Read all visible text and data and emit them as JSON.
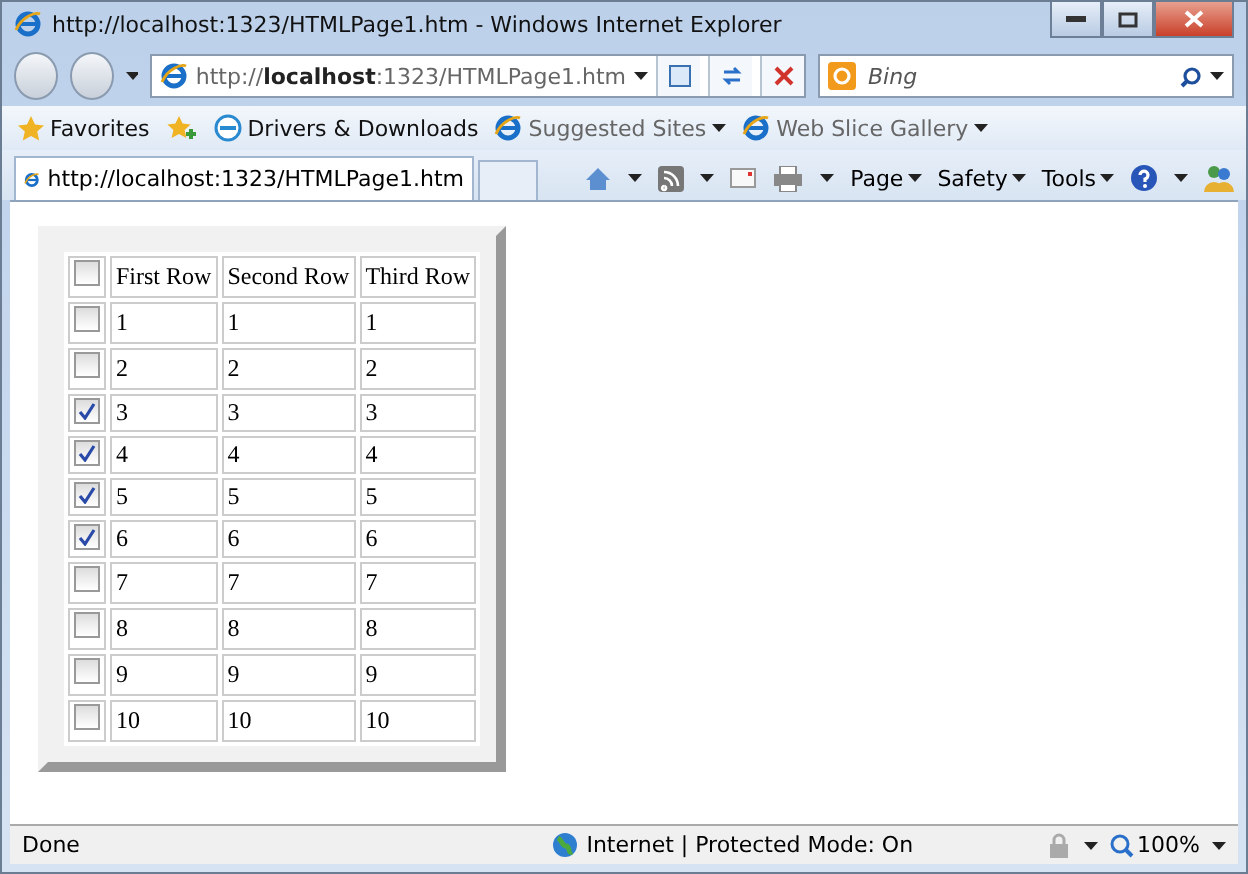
{
  "window": {
    "title": "http://localhost:1323/HTMLPage1.htm - Windows Internet Explorer"
  },
  "address": {
    "url": "http://**localhost**:1323/HTMLPage1.htm"
  },
  "search": {
    "placeholder": "Bing"
  },
  "favorites": {
    "label": "Favorites",
    "links": [
      {
        "label": "Drivers & Downloads",
        "kind": "dell",
        "dim": false,
        "dropdown": false
      },
      {
        "label": "Suggested Sites",
        "kind": "ie",
        "dim": true,
        "dropdown": true
      },
      {
        "label": "Web Slice Gallery",
        "kind": "ie",
        "dim": true,
        "dropdown": true
      }
    ]
  },
  "tab": {
    "title": "http://localhost:1323/HTMLPage1.htm"
  },
  "commands": [
    "Page",
    "Safety",
    "Tools"
  ],
  "table": {
    "header_checked": false,
    "columns": [
      "First Row",
      "Second Row",
      "Third Row"
    ],
    "rows": [
      {
        "checked": false,
        "cells": [
          "1",
          "1",
          "1"
        ]
      },
      {
        "checked": false,
        "cells": [
          "2",
          "2",
          "2"
        ]
      },
      {
        "checked": true,
        "cells": [
          "3",
          "3",
          "3"
        ]
      },
      {
        "checked": true,
        "cells": [
          "4",
          "4",
          "4"
        ]
      },
      {
        "checked": true,
        "cells": [
          "5",
          "5",
          "5"
        ]
      },
      {
        "checked": true,
        "cells": [
          "6",
          "6",
          "6"
        ]
      },
      {
        "checked": false,
        "cells": [
          "7",
          "7",
          "7"
        ]
      },
      {
        "checked": false,
        "cells": [
          "8",
          "8",
          "8"
        ]
      },
      {
        "checked": false,
        "cells": [
          "9",
          "9",
          "9"
        ]
      },
      {
        "checked": false,
        "cells": [
          "10",
          "10",
          "10"
        ]
      }
    ]
  },
  "status": {
    "text": "Done",
    "zone": "Internet | Protected Mode: On",
    "zoom": "100%"
  }
}
